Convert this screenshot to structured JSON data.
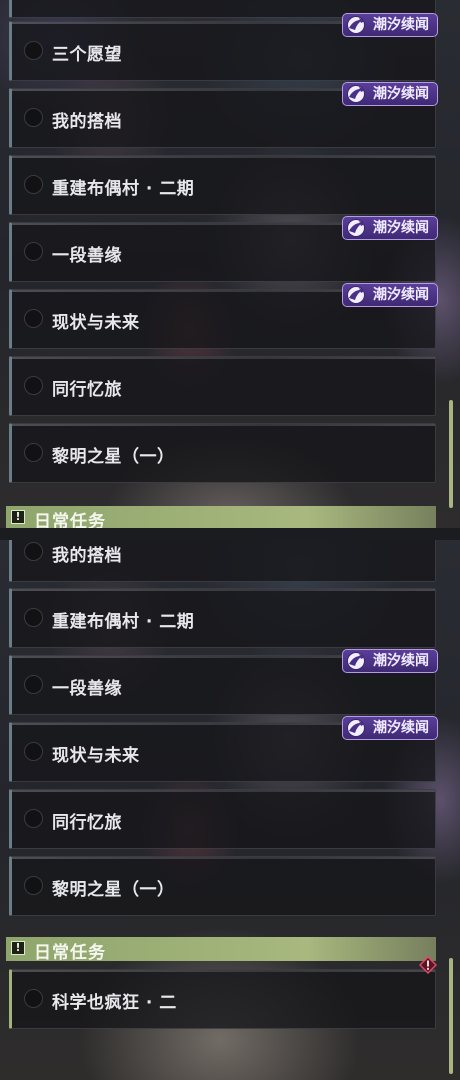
{
  "tag_label": "潮汐续闻",
  "daily_header": "日常任务",
  "top_panel": {
    "quests": [
      {
        "title": "",
        "tag": true
      },
      {
        "title": "三个愿望",
        "tag": true
      },
      {
        "title": "我的搭档",
        "tag": false
      },
      {
        "title": "重建布偶村 · 二期",
        "tag": true
      },
      {
        "title": "一段善缘",
        "tag": true
      },
      {
        "title": "现状与未来",
        "tag": false
      },
      {
        "title": "同行忆旅",
        "tag": false
      },
      {
        "title": "黎明之星（一）",
        "tag": false
      }
    ]
  },
  "bottom_panel": {
    "quests": [
      {
        "title": "我的搭档",
        "tag": false
      },
      {
        "title": "重建布偶村 · 二期",
        "tag": true
      },
      {
        "title": "一段善缘",
        "tag": true
      },
      {
        "title": "现状与未来",
        "tag": false
      },
      {
        "title": "同行忆旅",
        "tag": false
      },
      {
        "title": "黎明之星（一）",
        "tag": false
      }
    ],
    "daily_quests": [
      {
        "title": "科学也疯狂 · 二",
        "alert": true
      }
    ]
  },
  "colors": {
    "tag_bg": "#4b3386",
    "tag_border": "#b49be6",
    "daily_accent": "#a3b27a",
    "alert": "#d33a55"
  },
  "icons": {
    "tag": "tidal-story-icon",
    "alert": "exclamation-diamond-icon",
    "section": "exclamation-box-icon"
  }
}
